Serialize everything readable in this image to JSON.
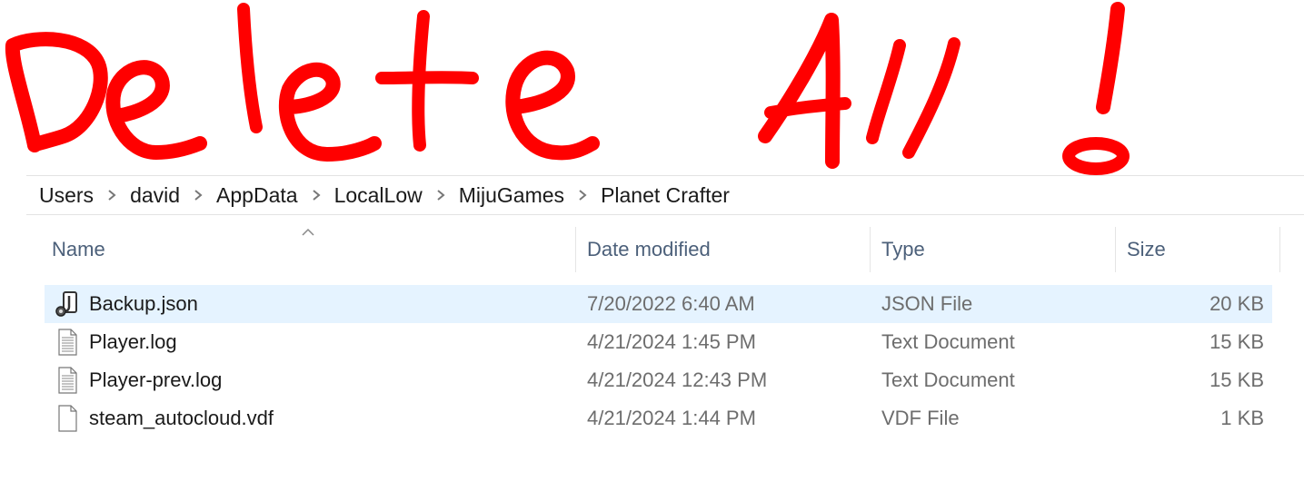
{
  "annotation": {
    "text": "Delete All !",
    "color": "#ff0000"
  },
  "breadcrumb": {
    "items": [
      "Users",
      "david",
      "AppData",
      "LocalLow",
      "MijuGames",
      "Planet Crafter"
    ],
    "separator_icon": "chevron-right-icon"
  },
  "columns": {
    "name": "Name",
    "date": "Date modified",
    "type": "Type",
    "size": "Size",
    "sorted_by": "name",
    "sort_icon": "chevron-up-icon"
  },
  "files": [
    {
      "name": "Backup.json",
      "date": "7/20/2022 6:40 AM",
      "type": "JSON File",
      "size": "20 KB",
      "icon": "json-file-icon",
      "selected": true
    },
    {
      "name": "Player.log",
      "date": "4/21/2024 1:45 PM",
      "type": "Text Document",
      "size": "15 KB",
      "icon": "text-file-icon",
      "selected": false
    },
    {
      "name": "Player-prev.log",
      "date": "4/21/2024 12:43 PM",
      "type": "Text Document",
      "size": "15 KB",
      "icon": "text-file-icon",
      "selected": false
    },
    {
      "name": "steam_autocloud.vdf",
      "date": "4/21/2024 1:44 PM",
      "type": "VDF File",
      "size": "1 KB",
      "icon": "blank-file-icon",
      "selected": false
    }
  ],
  "colors": {
    "selection": "#e5f3ff",
    "header_text": "#4c607a",
    "annotation": "#ff0000"
  }
}
